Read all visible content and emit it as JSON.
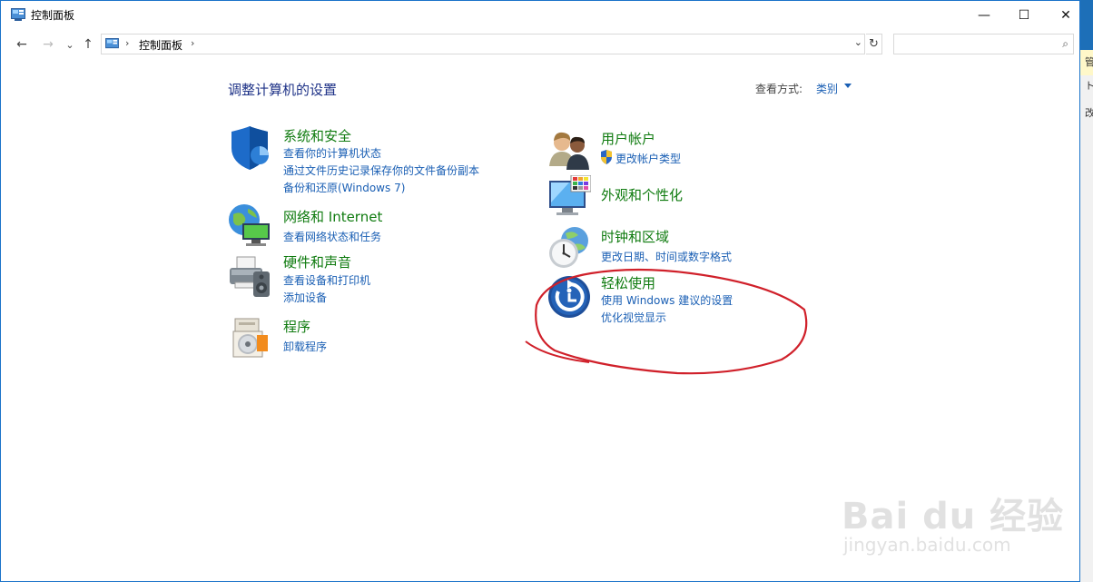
{
  "window": {
    "title": "控制面板"
  },
  "controls": {
    "minimize": "—",
    "maximize": "☐",
    "close": "✕"
  },
  "nav": {
    "back": "←",
    "forward": "→",
    "recent": "⌄",
    "up": "↑"
  },
  "address": {
    "separator": "›",
    "crumb": "控制面板",
    "dropdown": "⌄",
    "refresh": "↻"
  },
  "search": {
    "placeholder": "",
    "icon": "⌕"
  },
  "content": {
    "heading": "调整计算机的设置",
    "view_by_label": "查看方式:",
    "view_by_value": "类别"
  },
  "categories": [
    {
      "title": "系统和安全",
      "icon": "shield-icon",
      "links": [
        "查看你的计算机状态",
        "通过文件历史记录保存你的文件备份副本",
        "备份和还原(Windows 7)"
      ]
    },
    {
      "title": "网络和 Internet",
      "icon": "network-globe-icon",
      "links": [
        "查看网络状态和任务"
      ]
    },
    {
      "title": "硬件和声音",
      "icon": "printer-speaker-icon",
      "links": [
        "查看设备和打印机",
        "添加设备"
      ]
    },
    {
      "title": "程序",
      "icon": "programs-disc-icon",
      "links": [
        "卸载程序"
      ]
    },
    {
      "title": "用户帐户",
      "icon": "users-icon",
      "links": [
        "更改帐户类型"
      ]
    },
    {
      "title": "外观和个性化",
      "icon": "monitor-palette-icon",
      "links": []
    },
    {
      "title": "时钟和区域",
      "icon": "clock-globe-icon",
      "links": [
        "更改日期、时间或数字格式"
      ]
    },
    {
      "title": "轻松使用",
      "icon": "ease-of-access-icon",
      "links": [
        "使用 Windows 建议的设置",
        "优化视觉显示"
      ]
    }
  ],
  "strip": {
    "chars": [
      "管",
      "ト",
      "改"
    ]
  },
  "watermark": {
    "brand": "Bai du 经验",
    "url": "jingyan.baidu.com"
  },
  "colors": {
    "link": "#1a5fb4",
    "category_title": "#0f7b0f",
    "heading": "#1e3287",
    "annotation": "#d0202a",
    "window_border": "#1a73c9"
  }
}
